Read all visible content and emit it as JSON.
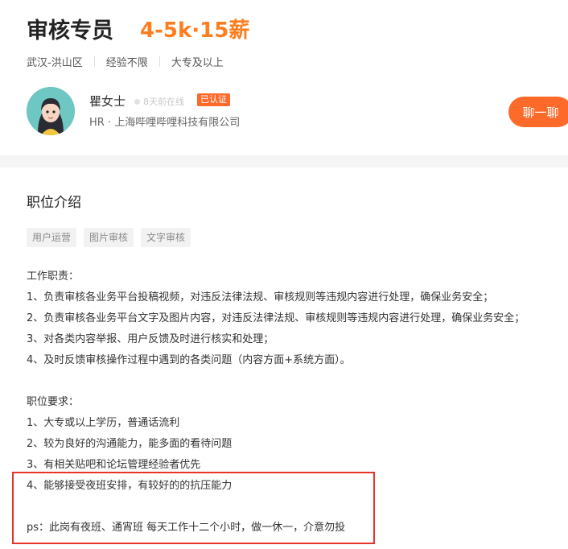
{
  "job": {
    "title": "审核专员",
    "salary": "4-5k·15薪",
    "location": "武汉-洪山区",
    "experience": "经验不限",
    "education": "大专及以上"
  },
  "hr": {
    "name": "瞿女士",
    "online_status": "8天前在线",
    "verified_badge": "已认证",
    "company": "HR · 上海哔哩哔哩科技有限公司",
    "chat_button": "聊一聊"
  },
  "description": {
    "section_title": "职位介绍",
    "tags": [
      "用户运营",
      "图片审核",
      "文字审核"
    ],
    "duties_title": "工作职责：",
    "duties": [
      "1、负责审核各业务平台投稿视频，对违反法律法规、审核规则等违规内容进行处理，确保业务安全；",
      "2、负责审核各业务平台文字及图片内容，对违反法律法规、审核规则等违规内容进行处理，确保业务安全；",
      "3、对各类内容举报、用户反馈及时进行核实和处理；",
      "4、及时反馈审核操作过程中遇到的各类问题（内容方面+系统方面）。"
    ],
    "requirements_title": "职位要求：",
    "requirements": [
      "1、大专或以上学历，普通话流利",
      "2、较为良好的沟通能力，能多面的看待问题",
      "3、有相关贴吧和论坛管理经验者优先",
      "4、能够接受夜班安排，有较好的的抗压能力"
    ],
    "ps": "ps：此岗有夜班、通宵班  每天工作十二个小时，做一休一，介意勿投"
  }
}
